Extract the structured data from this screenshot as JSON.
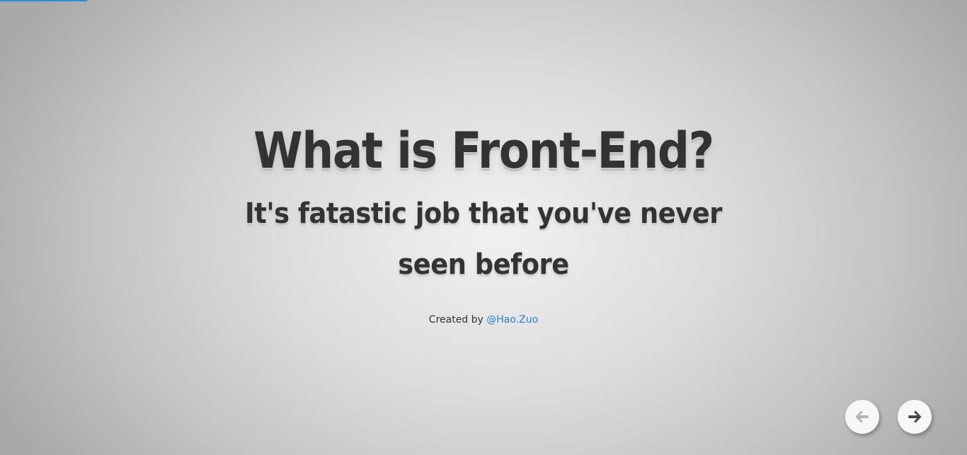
{
  "progress": {
    "fraction": 0.09,
    "color": "#2a8fe0"
  },
  "slide": {
    "title": "What is Front-End?",
    "subtitle": "It's fatastic job that you've never seen before",
    "credit_prefix": "Created by ",
    "credit_link": "@Hao.Zuo"
  },
  "navigation": {
    "prev_icon": "arrow-left-icon",
    "next_icon": "arrow-right-icon",
    "prev_color": "#b3b3b3",
    "next_color": "#444444"
  },
  "colors": {
    "text": "#333333",
    "link": "#2a7fc8"
  }
}
